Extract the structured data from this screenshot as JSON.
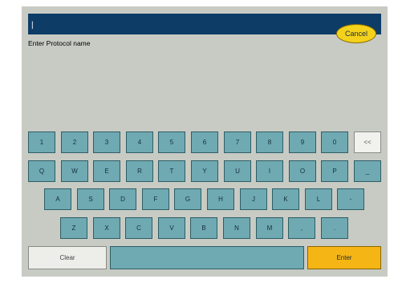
{
  "input": {
    "value": "|"
  },
  "prompt": "Enter Protocol name",
  "cancel_label": "Cancel",
  "keyboard": {
    "row1": [
      "1",
      "2",
      "3",
      "4",
      "5",
      "6",
      "7",
      "8",
      "9",
      "0",
      "<<"
    ],
    "row2": [
      "Q",
      "W",
      "E",
      "R",
      "T",
      "Y",
      "U",
      "I",
      "O",
      "P",
      "_"
    ],
    "row3": [
      "A",
      "S",
      "D",
      "F",
      "G",
      "H",
      "J",
      "K",
      "L",
      "-"
    ],
    "row4": [
      "Z",
      "X",
      "C",
      "V",
      "B",
      "N",
      "M",
      ",",
      "."
    ]
  },
  "clear_label": "Clear",
  "enter_label": "Enter",
  "colors": {
    "background": "#c8cbc4",
    "input_bar": "#0d3c67",
    "key": "#6fa9b1",
    "cancel": "#f4d21c",
    "enter": "#f5b515",
    "light_key": "#f1f1ee"
  }
}
